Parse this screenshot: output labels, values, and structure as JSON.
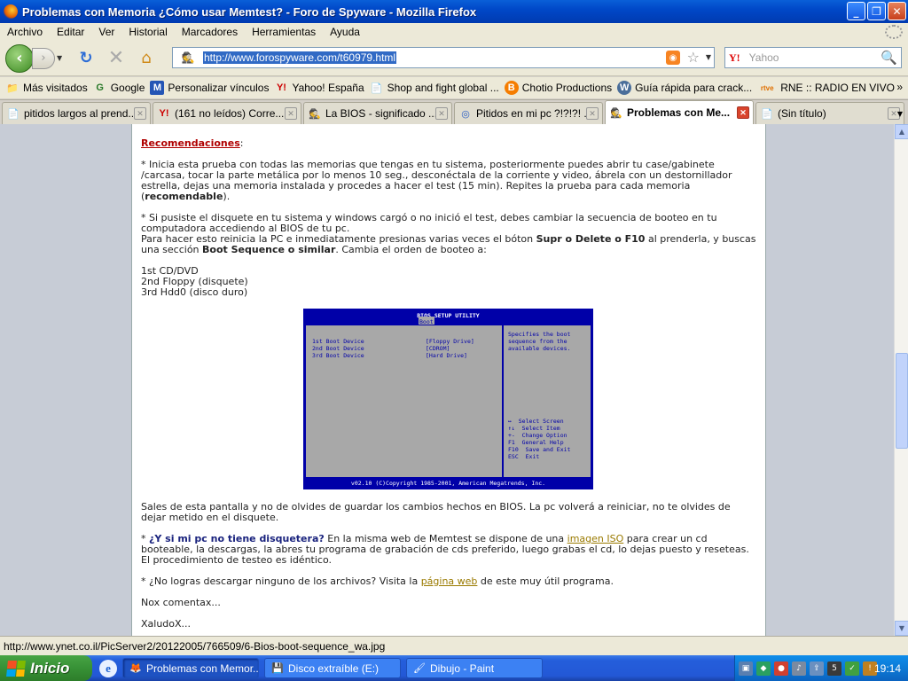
{
  "window": {
    "title": "Problemas con Memoria ¿Cómo usar Memtest? - Foro de Spyware - Mozilla Firefox",
    "minimize": "_",
    "maximize": "❐",
    "close": "✕"
  },
  "menu": [
    "Archivo",
    "Editar",
    "Ver",
    "Historial",
    "Marcadores",
    "Herramientas",
    "Ayuda"
  ],
  "nav": {
    "url": "http://www.forospyware.com/t60979.html",
    "search_placeholder": "Yahoo"
  },
  "bookmarks": [
    {
      "label": "Más visitados",
      "icon": "📁"
    },
    {
      "label": "Google",
      "icon": "G"
    },
    {
      "label": "Personalizar vínculos",
      "icon": "M"
    },
    {
      "label": "Yahoo! España",
      "icon": "Y!"
    },
    {
      "label": "Shop and fight global ...",
      "icon": "📄"
    },
    {
      "label": "Chotio Productions",
      "icon": "B"
    },
    {
      "label": "Guía rápida para crack...",
      "icon": "W"
    },
    {
      "label": "RNE :: RADIO EN VIVO",
      "icon": "rtve"
    }
  ],
  "tabs": [
    {
      "label": "pitidos largos al prend...",
      "icon": "📄",
      "active": false
    },
    {
      "label": "(161 no leídos) Corre...",
      "icon": "Y!",
      "active": false
    },
    {
      "label": "La BIOS - significado ...",
      "icon": "🕵",
      "active": false
    },
    {
      "label": "Pitidos en mi pc ?!?!?! ...",
      "icon": "◎",
      "active": false
    },
    {
      "label": "Problemas con Me...",
      "icon": "🕵",
      "active": true
    },
    {
      "label": "(Sin título)",
      "icon": "📄",
      "active": false
    }
  ],
  "article": {
    "rec_heading": "Recomendaciones",
    "p1": "* Inicia esta prueba con todas las memorias que tengas en tu sistema, posteriormente puedes abrir tu case/gabinete /carcasa, tocar la parte metálica por lo menos 10 seg., desconéctala de la corriente y video, ábrela con un destornillador estrella, dejas una memoria instalada y procedes a hacer el test (15 min). Repites la prueba para cada memoria (",
    "p1_bold": "recomendable",
    "p1_end": ").",
    "p2a": "* Si pusiste el disquete en tu sistema y windows cargó o no inició el test, debes cambiar la secuencia de booteo en tu computadora accediendo al BIOS de tu pc.",
    "p2b_start": "Para hacer esto reinicia la PC e inmediatamente presionas varias veces el bóton ",
    "p2b_bold1": "Supr o Delete o F10",
    "p2b_mid": " al prenderla, y buscas una sección ",
    "p2b_bold2": "Boot Sequence o similar",
    "p2b_end": ". Cambia el orden de booteo a:",
    "boot1": "1st CD/DVD",
    "boot2": "2nd Floppy (disquete)",
    "boot3": "3rd Hdd0 (disco duro)",
    "p3": "Sales de esta pantalla y no de olvides de guardar los cambios hechos en BIOS. La pc volverá a reiniciar, no te olvides de dejar metido en el disquete.",
    "q_heading": "¿Y si mi pc no tiene disquetera?",
    "p4_start": " En la misma web de Memtest se dispone de una ",
    "p4_link": "imagen ISO",
    "p4_end": " para crear un cd booteable, la descargas, la abres tu programa de grabación de cds preferido, luego grabas el cd, lo dejas puesto y reseteas. El procedimiento de testeo es idéntico.",
    "p5_start": "* ¿No logras descargar ninguno de los archivos? Visita la ",
    "p5_link": "página web",
    "p5_end": " de este muy útil programa.",
    "sign1": "Nox comentax...",
    "sign2": "XaludoX..."
  },
  "bios": {
    "header": "BIOS SETUP UTILITY",
    "tab": "Boot",
    "rows": [
      {
        "label": "1st Boot Device",
        "value": "[Floppy Drive]"
      },
      {
        "label": "2nd Boot Device",
        "value": "[CDROM]"
      },
      {
        "label": "3rd Boot Device",
        "value": "[Hard Drive]"
      }
    ],
    "help1": "Specifies the boot",
    "help2": "sequence from the",
    "help3": "available devices.",
    "keys": [
      {
        "key": "↔",
        "desc": "Select Screen"
      },
      {
        "key": "↑↓",
        "desc": "Select Item"
      },
      {
        "key": "+-",
        "desc": "Change Option"
      },
      {
        "key": "F1",
        "desc": "General Help"
      },
      {
        "key": "F10",
        "desc": "Save and Exit"
      },
      {
        "key": "ESC",
        "desc": "Exit"
      }
    ],
    "footer": "v02.10 (C)Copyright 1985-2001, American Megatrends, Inc."
  },
  "status": {
    "text": "http://www.ynet.co.il/PicServer2/20122005/766509/6-Bios-boot-sequence_wa.jpg"
  },
  "taskbar": {
    "start": "Inicio",
    "tasks": [
      {
        "label": "Problemas con Memor...",
        "icon": "🦊",
        "active": true
      },
      {
        "label": "Disco extraíble (E:)",
        "icon": "💾",
        "active": false
      },
      {
        "label": "Dibujo - Paint",
        "icon": "🖌",
        "active": false
      }
    ],
    "clock": "19:14"
  },
  "colors": {
    "accent": "#0048c8",
    "heading_red": "#b00000",
    "link": "#9a7a00",
    "bios_blue": "#0000a8"
  }
}
